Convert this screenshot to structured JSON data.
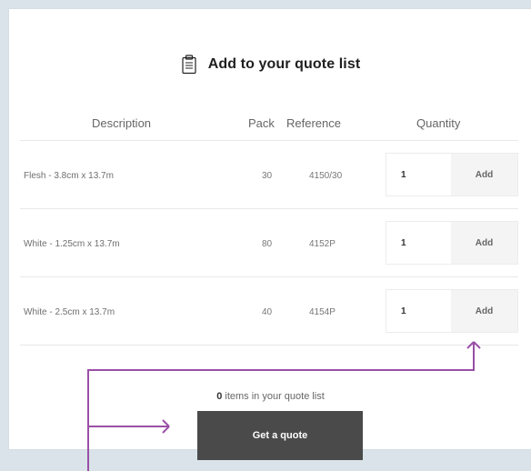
{
  "header": {
    "title": "Add to your quote list"
  },
  "table": {
    "columns": {
      "description": "Description",
      "pack": "Pack",
      "reference": "Reference",
      "quantity": "Quantity"
    },
    "rows": [
      {
        "description": "Flesh - 3.8cm x 13.7m",
        "pack": "30",
        "reference": "4150/30",
        "quantity": "1",
        "action": "Add"
      },
      {
        "description": "White - 1.25cm x 13.7m",
        "pack": "80",
        "reference": "4152P",
        "quantity": "1",
        "action": "Add"
      },
      {
        "description": "White - 2.5cm x 13.7m",
        "pack": "40",
        "reference": "4154P",
        "quantity": "1",
        "action": "Add"
      }
    ]
  },
  "summary": {
    "count": "0",
    "text": "items in your quote list"
  },
  "actions": {
    "quote_button": "Get a quote"
  },
  "colors": {
    "page_bg": "#d9e3e9",
    "card_bg": "#ffffff",
    "primary_button": "#4a4a4a",
    "annotation": "#9a4fa6"
  },
  "icons": {
    "title_icon": "clipboard-icon"
  }
}
